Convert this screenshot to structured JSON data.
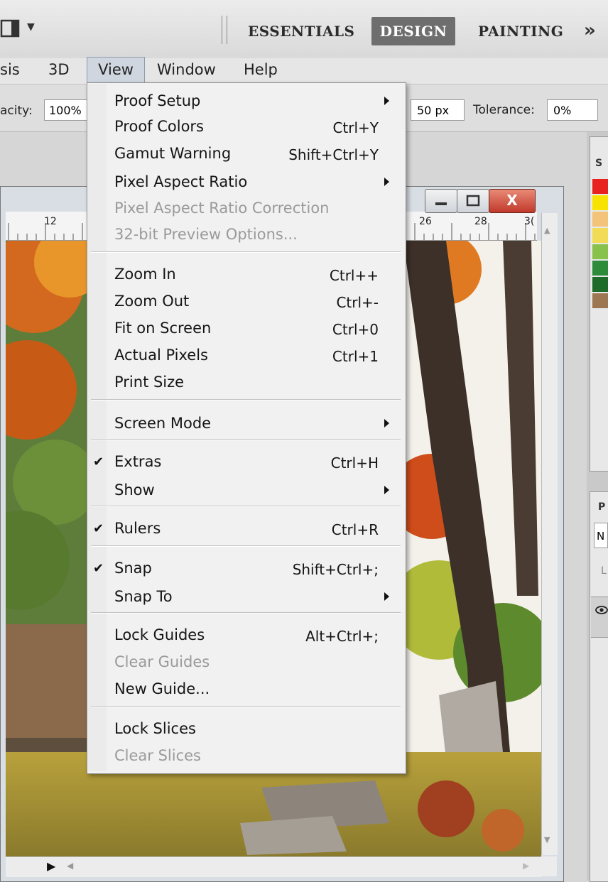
{
  "workspace": {
    "layout_icon": "screen-layout-icon",
    "tabs": [
      {
        "label": "ESSENTIALS"
      },
      {
        "label": "DESIGN"
      },
      {
        "label": "PAINTING"
      }
    ],
    "more": "»"
  },
  "menubar": {
    "items": [
      {
        "label": "sis"
      },
      {
        "label": "3D"
      },
      {
        "label": "View"
      },
      {
        "label": "Window"
      },
      {
        "label": "Help"
      }
    ]
  },
  "options": {
    "opacity_label": "acity:",
    "opacity_value": "100%",
    "size_value": "50 px",
    "tolerance_label": "Tolerance:",
    "tolerance_value": "0%"
  },
  "panels": {
    "swatches_tab": "S",
    "swatch_colors": [
      "#e8231f",
      "#f7e200",
      "#f4c37a",
      "#f3dc55",
      "#88c24b",
      "#2e8b3a",
      "#1f6b2a",
      "#9c7752"
    ],
    "layers_tab": "P",
    "layers_field": "N",
    "layers_lock": "L"
  },
  "document": {
    "ruler_marks": [
      "12",
      "26",
      "28",
      "3("
    ],
    "window_buttons": {
      "min": "—",
      "max": "◻",
      "close": "X"
    }
  },
  "view_menu": {
    "items": [
      {
        "label": "Proof Setup",
        "submenu": true
      },
      {
        "label": "Proof Colors",
        "shortcut": "Ctrl+Y"
      },
      {
        "label": "Gamut Warning",
        "shortcut": "Shift+Ctrl+Y"
      },
      {
        "label": "Pixel Aspect Ratio",
        "submenu": true
      },
      {
        "label": "Pixel Aspect Ratio Correction",
        "disabled": true
      },
      {
        "label": "32-bit Preview Options...",
        "disabled": true
      },
      {
        "label": "Zoom In",
        "shortcut": "Ctrl++"
      },
      {
        "label": "Zoom Out",
        "shortcut": "Ctrl+-"
      },
      {
        "label": "Fit on Screen",
        "shortcut": "Ctrl+0"
      },
      {
        "label": "Actual Pixels",
        "shortcut": "Ctrl+1"
      },
      {
        "label": "Print Size"
      },
      {
        "label": "Screen Mode",
        "submenu": true
      },
      {
        "label": "Extras",
        "shortcut": "Ctrl+H",
        "checked": true
      },
      {
        "label": "Show",
        "submenu": true
      },
      {
        "label": "Rulers",
        "shortcut": "Ctrl+R",
        "checked": true
      },
      {
        "label": "Snap",
        "shortcut": "Shift+Ctrl+;",
        "checked": true
      },
      {
        "label": "Snap To",
        "submenu": true
      },
      {
        "label": "Lock Guides",
        "shortcut": "Alt+Ctrl+;"
      },
      {
        "label": "Clear Guides",
        "disabled": true
      },
      {
        "label": "New Guide..."
      },
      {
        "label": "Lock Slices"
      },
      {
        "label": "Clear Slices",
        "disabled": true
      }
    ]
  }
}
